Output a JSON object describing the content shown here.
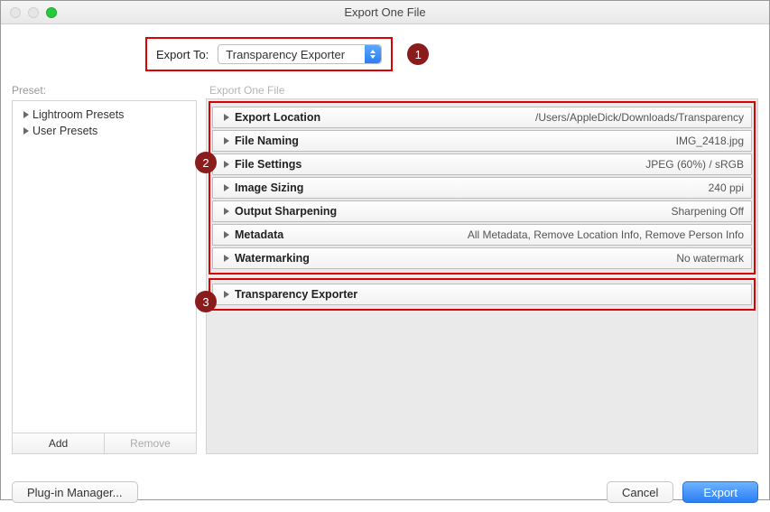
{
  "window": {
    "title": "Export One File"
  },
  "exportTo": {
    "label": "Export To:",
    "value": "Transparency Exporter"
  },
  "annotations": {
    "b1": "1",
    "b2": "2",
    "b3": "3"
  },
  "preset": {
    "label": "Preset:",
    "items": [
      "Lightroom Presets",
      "User Presets"
    ],
    "addLabel": "Add",
    "removeLabel": "Remove"
  },
  "panelGroup": {
    "label": "Export One File",
    "rows": [
      {
        "title": "Export Location",
        "value": "/Users/AppleDick/Downloads/Transparency"
      },
      {
        "title": "File Naming",
        "value": "IMG_2418.jpg"
      },
      {
        "title": "File Settings",
        "value": "JPEG (60%) / sRGB"
      },
      {
        "title": "Image Sizing",
        "value": "240 ppi"
      },
      {
        "title": "Output Sharpening",
        "value": "Sharpening Off"
      },
      {
        "title": "Metadata",
        "value": "All Metadata, Remove Location Info, Remove Person Info"
      },
      {
        "title": "Watermarking",
        "value": "No watermark"
      }
    ],
    "extraRow": {
      "title": "Transparency Exporter",
      "value": ""
    }
  },
  "footer": {
    "pluginManager": "Plug-in Manager...",
    "cancel": "Cancel",
    "export": "Export"
  }
}
